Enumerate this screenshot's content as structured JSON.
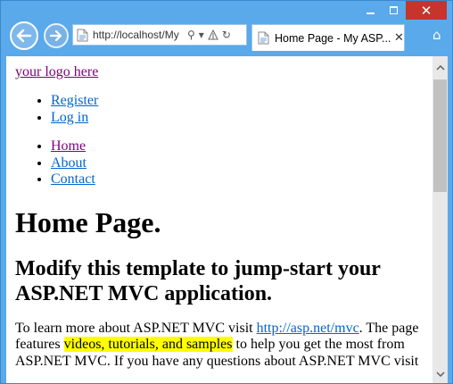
{
  "browser": {
    "address_url": "http://localhost/My",
    "tab_title": "Home Page - My ASP....",
    "colors": {
      "frame": "#5aa9ea",
      "close_button": "#c7342b"
    }
  },
  "page": {
    "logo_text": "your logo here",
    "login_links": [
      "Register",
      "Log in"
    ],
    "menu_links": [
      "Home",
      "About",
      "Contact"
    ],
    "heading": "Home Page.",
    "subheading": "Modify this template to jump-start your ASP.NET MVC application.",
    "paragraph": {
      "part1": "To learn more about ASP.NET MVC visit ",
      "link": "http://asp.net/mvc",
      "part2": ". The page features ",
      "highlight": "videos, tutorials, and samples",
      "part3": " to help you get the most from ASP.NET MVC. If you have any questions about ASP.NET MVC visit"
    },
    "colors": {
      "link": "#0066cc",
      "visited": "#800080",
      "highlight": "#ffff00"
    }
  }
}
